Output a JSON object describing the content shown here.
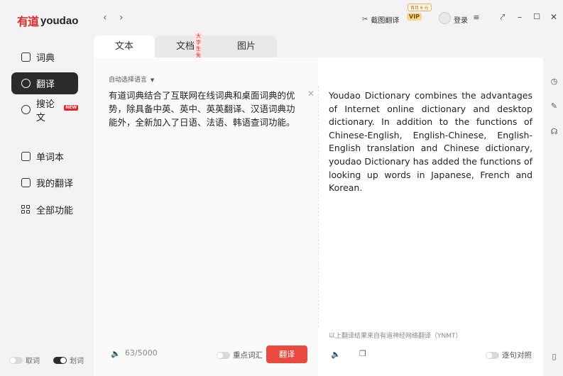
{
  "app": {
    "logo_mark": "有道",
    "logo_text": "youdao"
  },
  "sidebar": {
    "items": [
      {
        "label": "词典",
        "icon": "book-icon"
      },
      {
        "label": "翻译",
        "icon": "translate-icon",
        "active": true
      },
      {
        "label": "搜论文",
        "icon": "search-paper-icon",
        "badge": "NEW"
      },
      {
        "label": "单词本",
        "icon": "wordbook-icon"
      },
      {
        "label": "我的翻译",
        "icon": "my-translation-icon"
      },
      {
        "label": "全部功能",
        "icon": "grid-icon"
      }
    ],
    "toggles": [
      {
        "label": "取词",
        "on": false
      },
      {
        "label": "划词",
        "on": true
      }
    ]
  },
  "topbar": {
    "screenshot_translate": "截图翻译",
    "vip_label": "VIP",
    "vip_promo": "首月 6 元",
    "login": "登录"
  },
  "tabs": [
    {
      "label": "文本",
      "active": true
    },
    {
      "label": "文档",
      "badge": "大学生免费"
    },
    {
      "label": "图片"
    }
  ],
  "source": {
    "language_select": "自动选择语言",
    "text": "有道词典结合了互联网在线词典和桌面词典的优势，除具备中英、英中、英英翻译、汉语词典功能外，全新加入了日语、法语、韩语查词功能。",
    "char_count": "63/5000",
    "keyword_label": "重点词汇",
    "translate_button": "翻译"
  },
  "target": {
    "text": "Youdao Dictionary combines the advantages of Internet online dictionary and desktop dictionary. In addition to the functions of Chinese-English, English-Chinese, English-English translation and Chinese dictionary, youdao Dictionary has added the functions of looking up words in Japanese, French and Korean.",
    "note": "以上翻译结果来自有道神经网络翻译（YNMT）",
    "align_label": "逐句对照"
  },
  "colors": {
    "brand": "#e3262a",
    "translate_button": "#e94a3f",
    "active_nav": "#2b2b2b"
  }
}
